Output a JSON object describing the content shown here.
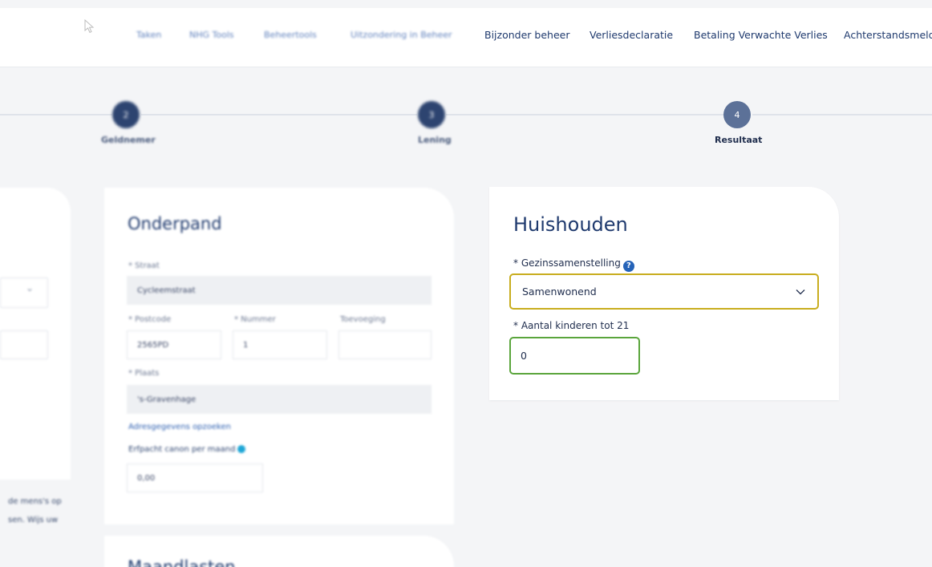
{
  "nav": {
    "items": [
      {
        "label": "Taken",
        "blurred": true
      },
      {
        "label": "NHG Tools",
        "blurred": true
      },
      {
        "label": "Beheertools",
        "blurred": true
      },
      {
        "label": "Uitzondering in Beheer",
        "blurred": true
      },
      {
        "label": "Bijzonder beheer",
        "blurred": false
      },
      {
        "label": "Verliesdeclaratie",
        "blurred": false
      },
      {
        "label": "Betaling Verwachte Verlies",
        "blurred": false
      },
      {
        "label": "Achterstandsmeldi",
        "blurred": false
      }
    ]
  },
  "stepper": {
    "steps": [
      {
        "number": "2",
        "label": "Geldnemer"
      },
      {
        "number": "3",
        "label": "Lening"
      },
      {
        "number": "4",
        "label": "Resultaat"
      }
    ]
  },
  "left_card": {
    "notes": [
      "de mens's op",
      "sen. Wijs uw"
    ]
  },
  "onderpand": {
    "title": "Onderpand",
    "straat_label": "* Straat",
    "straat_value": "Cycleemstraat",
    "postcode_label": "* Postcode",
    "postcode_value": "2565PD",
    "nummer_label": "* Nummer",
    "nummer_value": "1",
    "toevoeging_label": "Toevoeging",
    "plaats_label": "* Plaats",
    "plaats_value": "'s-Gravenhage",
    "adres_link": "Adresgegevens opzoeken",
    "erfpacht_label": "Erfpacht canon per maand",
    "erfpacht_value": "0,00"
  },
  "bottom_card": {
    "title": "Maandlasten"
  },
  "huishouden": {
    "title": "Huishouden",
    "gezin_label": "* Gezinssamenstelling",
    "gezin_value": "Samenwonend",
    "kinderen_label": "* Aantal kinderen tot 21",
    "kinderen_value": "0",
    "select_border_color": "#c8ad1e",
    "input_border_color": "#5aa53c"
  }
}
